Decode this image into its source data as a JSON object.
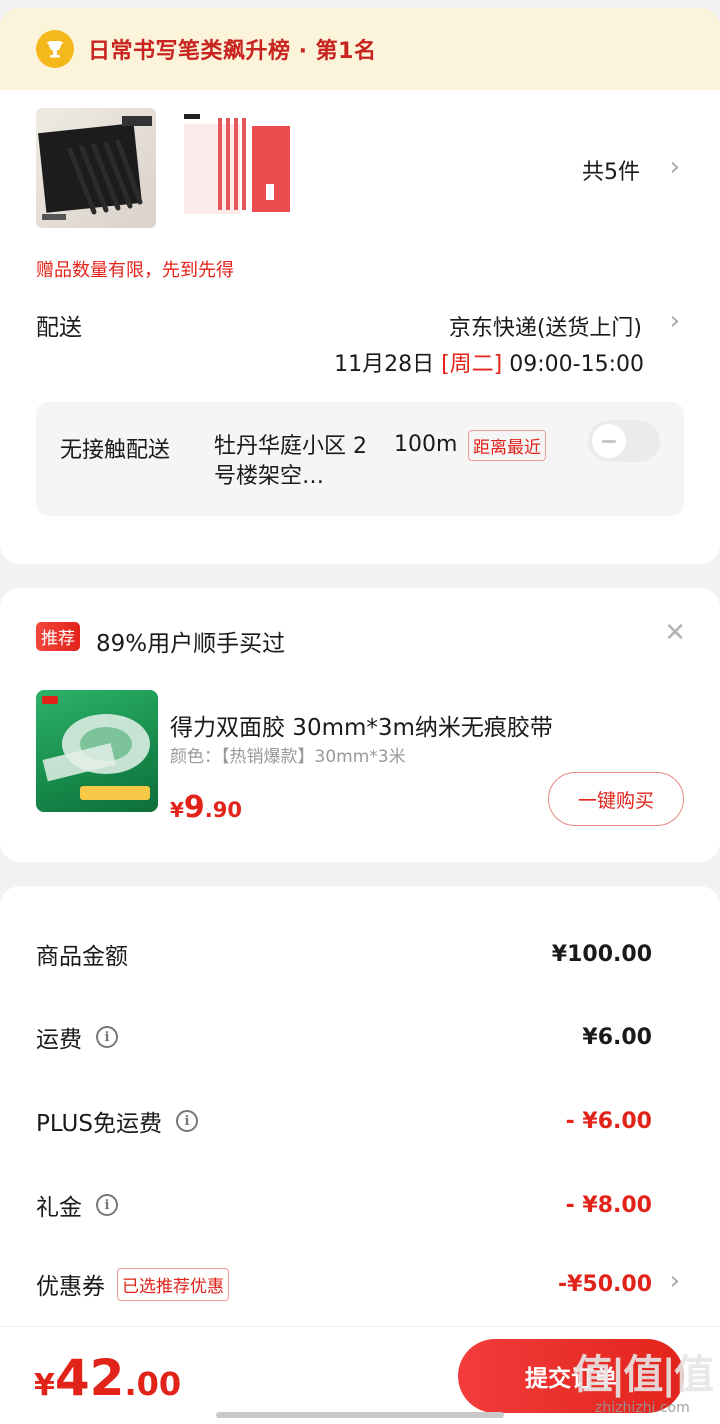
{
  "ranking": {
    "text": "日常书写笔类飙升榜 · 第1名"
  },
  "products": {
    "count": "共5件"
  },
  "gift_note": "赠品数量有限，先到先得",
  "shipping": {
    "label": "配送",
    "method": "京东快递(送货上门)",
    "date": "11月28日",
    "weekday": "[周二]",
    "time": "09:00-15:00"
  },
  "contactless": {
    "label": "无接触配送",
    "address": "牡丹华庭小区 2号楼架空…",
    "distance": "100m",
    "tag": "距离最近"
  },
  "recommend": {
    "badge": "推荐",
    "title": "89%用户顺手买过",
    "name": "得力双面胶 30mm*3m纳米无痕胶带",
    "spec": "颜色：【热销爆款】30mm*3米",
    "price_symbol": "¥",
    "price_int": "9",
    "price_dec": ".90",
    "buy_label": "一键购买"
  },
  "summary": {
    "goods_label": "商品金额",
    "goods_value": "¥100.00",
    "freight_label": "运费",
    "freight_value": "¥6.00",
    "plus_label": "PLUS免运费",
    "plus_value": "- ¥6.00",
    "gift_label": "礼金",
    "gift_value": "- ¥8.00",
    "coupon_label": "优惠券",
    "coupon_tag": "已选推荐优惠",
    "coupon_value": "-¥50.00"
  },
  "bottom": {
    "symbol": "¥",
    "total_int": "42",
    "total_dec": ".00",
    "submit_label": "提交订单"
  },
  "watermark": {
    "big": "值|值|值",
    "small": "zhizhizhi.com"
  },
  "icons": {
    "trophy": "trophy-icon",
    "chevron": "chevron-right-icon",
    "info": "info-icon",
    "close": "close-icon"
  },
  "colors": {
    "accent": "#e2231a",
    "rank_bg": "#fbf3da",
    "trophy": "#f5b81c"
  }
}
